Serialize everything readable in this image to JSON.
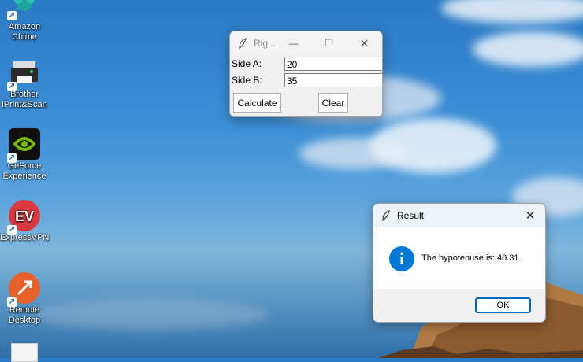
{
  "desktop": {
    "icons": [
      {
        "label": "Amazon Chime",
        "name": "amazon-chime"
      },
      {
        "label": "Brother iPrint&Scan",
        "name": "brother-iprint-scan"
      },
      {
        "label": "GeForce Experience",
        "name": "geforce-experience"
      },
      {
        "label": "ExpressVPN",
        "name": "expressvpn"
      },
      {
        "label": "Remote Desktop",
        "name": "remote-desktop"
      }
    ]
  },
  "calc_window": {
    "title": "Rig...",
    "side_a_label": "Side A:",
    "side_a_value": "20",
    "side_b_label": "Side B:",
    "side_b_value": "35",
    "calculate_label": "Calculate",
    "clear_label": "Clear",
    "minimize_glyph": "—",
    "maximize_glyph": "☐",
    "close_glyph": "✕"
  },
  "result_dialog": {
    "title": "Result",
    "message": "The hypotenuse is: 40.31",
    "ok_label": "OK",
    "close_glyph": "✕",
    "info_glyph": "i"
  },
  "colors": {
    "accent": "#0067c0",
    "info_icon": "#0078d4"
  }
}
